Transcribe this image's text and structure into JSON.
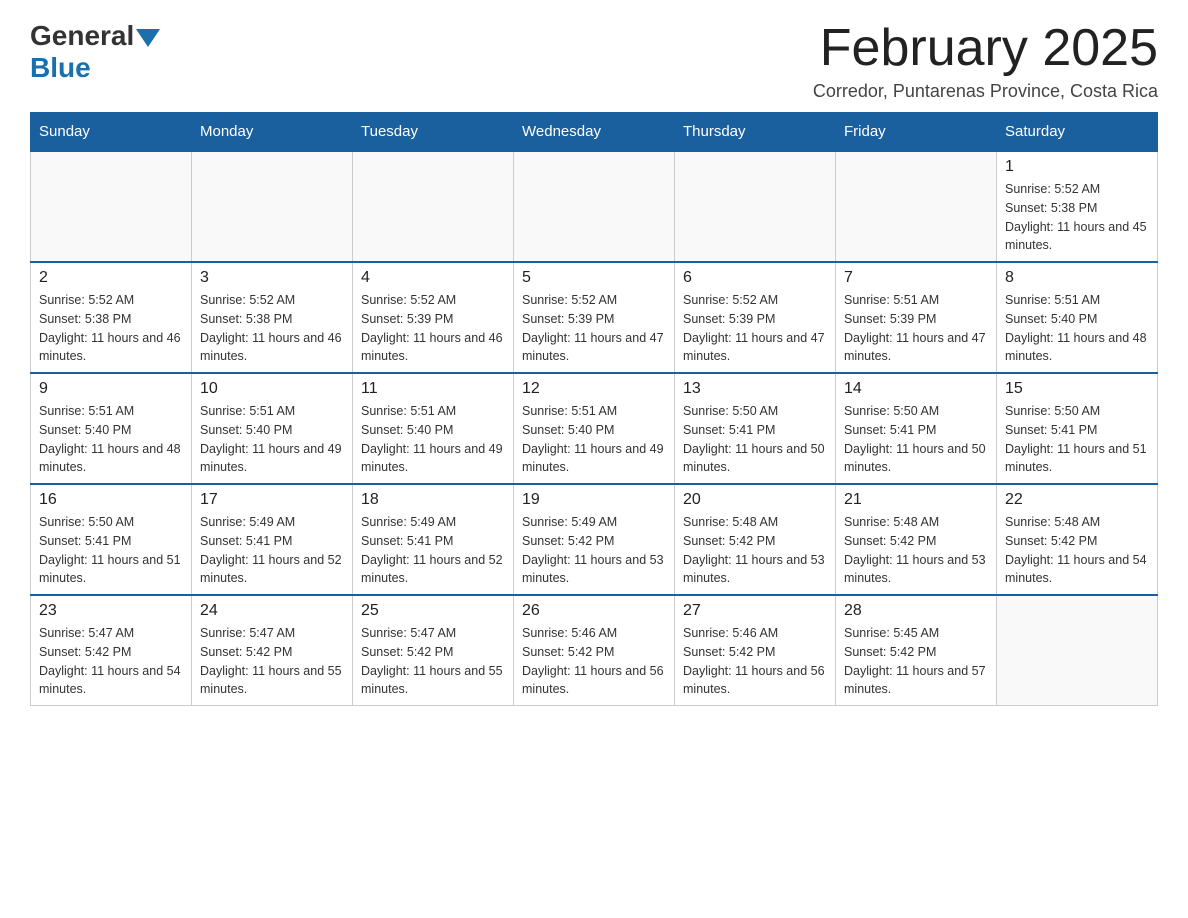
{
  "logo": {
    "general": "General",
    "blue": "Blue"
  },
  "title": "February 2025",
  "subtitle": "Corredor, Puntarenas Province, Costa Rica",
  "days_of_week": [
    "Sunday",
    "Monday",
    "Tuesday",
    "Wednesday",
    "Thursday",
    "Friday",
    "Saturday"
  ],
  "weeks": [
    [
      {
        "day": "",
        "info": ""
      },
      {
        "day": "",
        "info": ""
      },
      {
        "day": "",
        "info": ""
      },
      {
        "day": "",
        "info": ""
      },
      {
        "day": "",
        "info": ""
      },
      {
        "day": "",
        "info": ""
      },
      {
        "day": "1",
        "info": "Sunrise: 5:52 AM\nSunset: 5:38 PM\nDaylight: 11 hours and 45 minutes."
      }
    ],
    [
      {
        "day": "2",
        "info": "Sunrise: 5:52 AM\nSunset: 5:38 PM\nDaylight: 11 hours and 46 minutes."
      },
      {
        "day": "3",
        "info": "Sunrise: 5:52 AM\nSunset: 5:38 PM\nDaylight: 11 hours and 46 minutes."
      },
      {
        "day": "4",
        "info": "Sunrise: 5:52 AM\nSunset: 5:39 PM\nDaylight: 11 hours and 46 minutes."
      },
      {
        "day": "5",
        "info": "Sunrise: 5:52 AM\nSunset: 5:39 PM\nDaylight: 11 hours and 47 minutes."
      },
      {
        "day": "6",
        "info": "Sunrise: 5:52 AM\nSunset: 5:39 PM\nDaylight: 11 hours and 47 minutes."
      },
      {
        "day": "7",
        "info": "Sunrise: 5:51 AM\nSunset: 5:39 PM\nDaylight: 11 hours and 47 minutes."
      },
      {
        "day": "8",
        "info": "Sunrise: 5:51 AM\nSunset: 5:40 PM\nDaylight: 11 hours and 48 minutes."
      }
    ],
    [
      {
        "day": "9",
        "info": "Sunrise: 5:51 AM\nSunset: 5:40 PM\nDaylight: 11 hours and 48 minutes."
      },
      {
        "day": "10",
        "info": "Sunrise: 5:51 AM\nSunset: 5:40 PM\nDaylight: 11 hours and 49 minutes."
      },
      {
        "day": "11",
        "info": "Sunrise: 5:51 AM\nSunset: 5:40 PM\nDaylight: 11 hours and 49 minutes."
      },
      {
        "day": "12",
        "info": "Sunrise: 5:51 AM\nSunset: 5:40 PM\nDaylight: 11 hours and 49 minutes."
      },
      {
        "day": "13",
        "info": "Sunrise: 5:50 AM\nSunset: 5:41 PM\nDaylight: 11 hours and 50 minutes."
      },
      {
        "day": "14",
        "info": "Sunrise: 5:50 AM\nSunset: 5:41 PM\nDaylight: 11 hours and 50 minutes."
      },
      {
        "day": "15",
        "info": "Sunrise: 5:50 AM\nSunset: 5:41 PM\nDaylight: 11 hours and 51 minutes."
      }
    ],
    [
      {
        "day": "16",
        "info": "Sunrise: 5:50 AM\nSunset: 5:41 PM\nDaylight: 11 hours and 51 minutes."
      },
      {
        "day": "17",
        "info": "Sunrise: 5:49 AM\nSunset: 5:41 PM\nDaylight: 11 hours and 52 minutes."
      },
      {
        "day": "18",
        "info": "Sunrise: 5:49 AM\nSunset: 5:41 PM\nDaylight: 11 hours and 52 minutes."
      },
      {
        "day": "19",
        "info": "Sunrise: 5:49 AM\nSunset: 5:42 PM\nDaylight: 11 hours and 53 minutes."
      },
      {
        "day": "20",
        "info": "Sunrise: 5:48 AM\nSunset: 5:42 PM\nDaylight: 11 hours and 53 minutes."
      },
      {
        "day": "21",
        "info": "Sunrise: 5:48 AM\nSunset: 5:42 PM\nDaylight: 11 hours and 53 minutes."
      },
      {
        "day": "22",
        "info": "Sunrise: 5:48 AM\nSunset: 5:42 PM\nDaylight: 11 hours and 54 minutes."
      }
    ],
    [
      {
        "day": "23",
        "info": "Sunrise: 5:47 AM\nSunset: 5:42 PM\nDaylight: 11 hours and 54 minutes."
      },
      {
        "day": "24",
        "info": "Sunrise: 5:47 AM\nSunset: 5:42 PM\nDaylight: 11 hours and 55 minutes."
      },
      {
        "day": "25",
        "info": "Sunrise: 5:47 AM\nSunset: 5:42 PM\nDaylight: 11 hours and 55 minutes."
      },
      {
        "day": "26",
        "info": "Sunrise: 5:46 AM\nSunset: 5:42 PM\nDaylight: 11 hours and 56 minutes."
      },
      {
        "day": "27",
        "info": "Sunrise: 5:46 AM\nSunset: 5:42 PM\nDaylight: 11 hours and 56 minutes."
      },
      {
        "day": "28",
        "info": "Sunrise: 5:45 AM\nSunset: 5:42 PM\nDaylight: 11 hours and 57 minutes."
      },
      {
        "day": "",
        "info": ""
      }
    ]
  ]
}
